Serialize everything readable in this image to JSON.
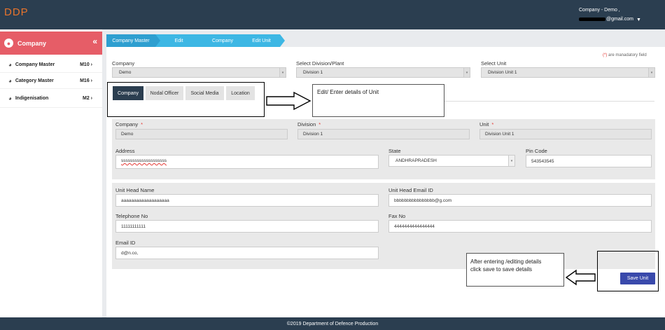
{
  "header": {
    "logo": "DDP",
    "company_line": "Company - Demo ,",
    "email_suffix": "@gmail.com"
  },
  "sidebar": {
    "title": "Company",
    "items": [
      {
        "label": "Company Master",
        "code": "M10"
      },
      {
        "label": "Category Master",
        "code": "M16"
      },
      {
        "label": "Indigenisation",
        "code": "M2"
      }
    ]
  },
  "breadcrumb": [
    "Company Master",
    "Edit",
    "Company",
    "Edit Unit"
  ],
  "mandatory_note": {
    "star": "(*)",
    "text": " are manadatory field"
  },
  "filters": {
    "company_label": "Company",
    "company_value": "Demo",
    "division_label": "Select Division/Plant",
    "division_value": "Division 1",
    "unit_label": "Select Unit",
    "unit_value": "Division Unit 1"
  },
  "tabs": [
    "Company",
    "Nodal Officer",
    "Social Media",
    "Location"
  ],
  "callouts": {
    "edit": "Edit/ Enter details of Unit",
    "save_line1": "After entering /editing details",
    "save_line2": "click save to save details"
  },
  "form": {
    "company_label": "Company",
    "company_value": "Demo",
    "division_label": "Division",
    "division_value": "Division 1",
    "unit_label": "Unit",
    "unit_value": "Division Unit 1",
    "address_label": "Address",
    "address_value": "ssssssssssssssssssss",
    "state_label": "State",
    "state_value": "ANDHRAPRADESH",
    "pincode_label": "Pin Code",
    "pincode_value": "543543545",
    "unit_head_label": "Unit Head Name",
    "unit_head_value": "aaaaaaaaaaaaaaaaaaa",
    "unit_head_email_label": "Unit Head Email ID",
    "unit_head_email_value": "bbbbbbbbbbbbbbbb@g.com",
    "telephone_label": "Telephone No",
    "telephone_value": "11111111111",
    "fax_label": "Fax No",
    "fax_value": "4444444444444444",
    "email_label": "Email ID",
    "email_value": "d@n.co,"
  },
  "save_button": "Save Unit",
  "footer": "©2019 Department of Defence Production",
  "colors": {
    "topbar": "#2b3e50",
    "accent_red": "#e65d67",
    "breadcrumb": "#3db7e4",
    "save_button": "#3949ab",
    "logo": "#e8742c"
  }
}
